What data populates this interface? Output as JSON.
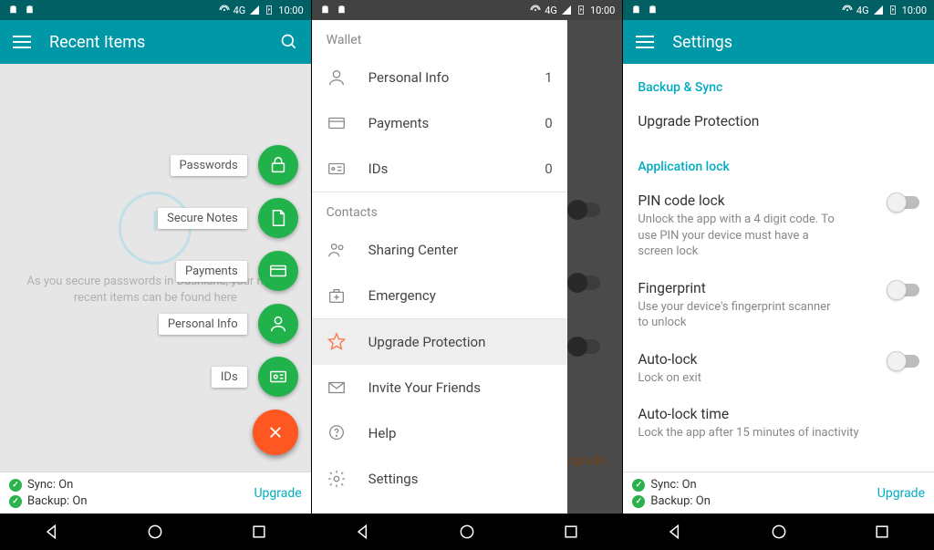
{
  "status": {
    "net": "4G",
    "clock": "10:00"
  },
  "screen1": {
    "title": "Recent Items",
    "empty_text": "As you secure passwords in Dashlane, your most recent items can be found here",
    "fab": {
      "passwords": "Passwords",
      "notes": "Secure Notes",
      "payments": "Payments",
      "personal": "Personal Info",
      "ids": "IDs"
    },
    "footer": {
      "sync": "Sync: On",
      "backup": "Backup: On",
      "upgrade": "Upgrade"
    }
  },
  "screen2": {
    "section_wallet": "Wallet",
    "section_contacts": "Contacts",
    "items": {
      "personal": "Personal Info",
      "personal_count": "1",
      "payments": "Payments",
      "payments_count": "0",
      "ids": "IDs",
      "ids_count": "0",
      "sharing": "Sharing Center",
      "emergency": "Emergency",
      "upgrade": "Upgrade Protection",
      "invite": "Invite Your Friends",
      "help": "Help",
      "settings": "Settings"
    },
    "bg_upgrade": "ograde"
  },
  "screen3": {
    "title": "Settings",
    "sec_backup": "Backup & Sync",
    "upgrade_protection": "Upgrade Protection",
    "sec_applock": "Application lock",
    "pin_title": "PIN code lock",
    "pin_sub": "Unlock the app with a 4 digit code. To use PIN your device must have a screen lock",
    "finger_title": "Fingerprint",
    "finger_sub": "Use your device's fingerprint scanner to unlock",
    "auto_title": "Auto-lock",
    "auto_sub": "Lock on exit",
    "autotime_title": "Auto-lock time",
    "autotime_sub": "Lock the app after 15 minutes of inactivity",
    "footer": {
      "sync": "Sync: On",
      "backup": "Backup: On",
      "upgrade": "Upgrade"
    }
  }
}
